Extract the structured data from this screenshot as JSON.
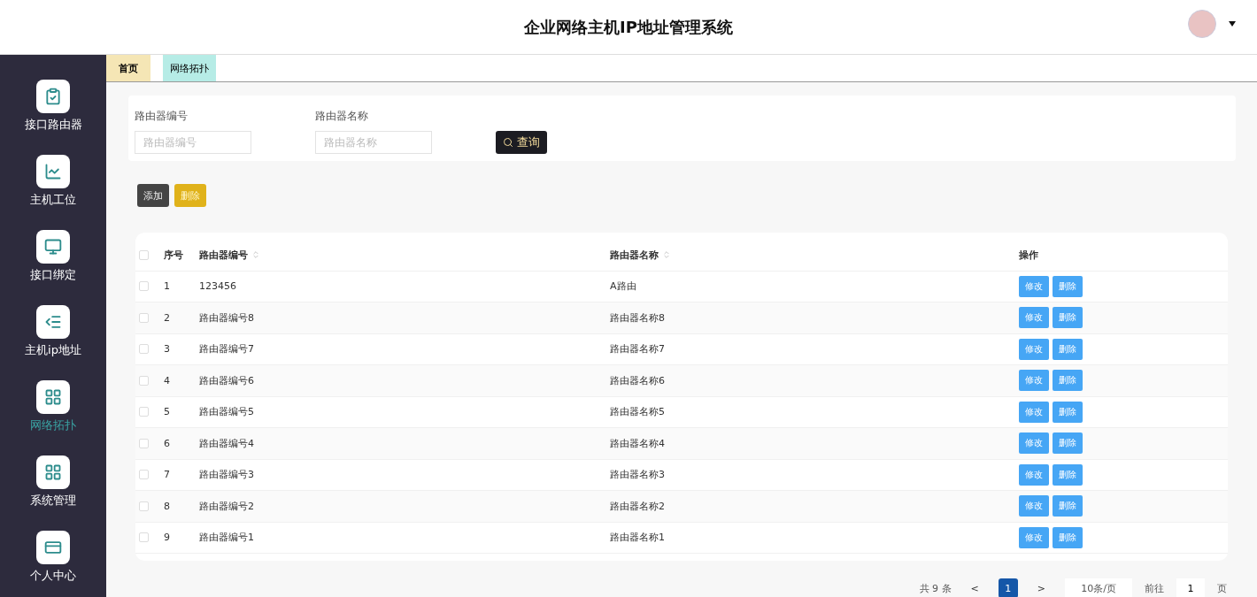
{
  "header": {
    "title": "企业网络主机IP地址管理系统"
  },
  "sidebar": {
    "items": [
      {
        "label": "接口路由器",
        "selected": false
      },
      {
        "label": "主机工位",
        "selected": false
      },
      {
        "label": "接口绑定",
        "selected": false
      },
      {
        "label": "主机ip地址",
        "selected": false
      },
      {
        "label": "网络拓扑",
        "selected": true
      },
      {
        "label": "系统管理",
        "selected": false
      },
      {
        "label": "个人中心",
        "selected": false
      }
    ]
  },
  "tabs": [
    {
      "label": "首页",
      "selected": true
    },
    {
      "label": "网络拓扑",
      "selected": false
    }
  ],
  "search": {
    "fields": [
      {
        "label": "路由器编号",
        "placeholder": "路由器编号"
      },
      {
        "label": "路由器名称",
        "placeholder": "路由器名称"
      }
    ],
    "button": "查询"
  },
  "actions": {
    "add": "添加",
    "delete": "删除"
  },
  "table": {
    "header_checked": false,
    "columns": [
      "序号",
      "路由器编号",
      "路由器名称",
      "操作"
    ],
    "rows": [
      {
        "checked": false,
        "cells": [
          "1",
          "123456",
          "A路由"
        ],
        "actions": [
          "修改",
          "删除"
        ]
      },
      {
        "checked": false,
        "cells": [
          "2",
          "路由器编号8",
          "路由器名称8"
        ],
        "actions": [
          "修改",
          "删除"
        ]
      },
      {
        "checked": false,
        "cells": [
          "3",
          "路由器编号7",
          "路由器名称7"
        ],
        "actions": [
          "修改",
          "删除"
        ]
      },
      {
        "checked": false,
        "cells": [
          "4",
          "路由器编号6",
          "路由器名称6"
        ],
        "actions": [
          "修改",
          "删除"
        ]
      },
      {
        "checked": false,
        "cells": [
          "5",
          "路由器编号5",
          "路由器名称5"
        ],
        "actions": [
          "修改",
          "删除"
        ]
      },
      {
        "checked": false,
        "cells": [
          "6",
          "路由器编号4",
          "路由器名称4"
        ],
        "actions": [
          "修改",
          "删除"
        ]
      },
      {
        "checked": false,
        "cells": [
          "7",
          "路由器编号3",
          "路由器名称3"
        ],
        "actions": [
          "修改",
          "删除"
        ]
      },
      {
        "checked": false,
        "cells": [
          "8",
          "路由器编号2",
          "路由器名称2"
        ],
        "actions": [
          "修改",
          "删除"
        ]
      },
      {
        "checked": false,
        "cells": [
          "9",
          "路由器编号1",
          "路由器名称1"
        ],
        "actions": [
          "修改",
          "删除"
        ]
      }
    ]
  },
  "pagination": {
    "total": "共 9 条",
    "prev": "<",
    "pages": [
      {
        "label": "1",
        "selected": true
      }
    ],
    "next": ">",
    "page_size": "10条/页",
    "goto_label": "前往",
    "goto_value": "1",
    "goto_suffix": "页"
  }
}
